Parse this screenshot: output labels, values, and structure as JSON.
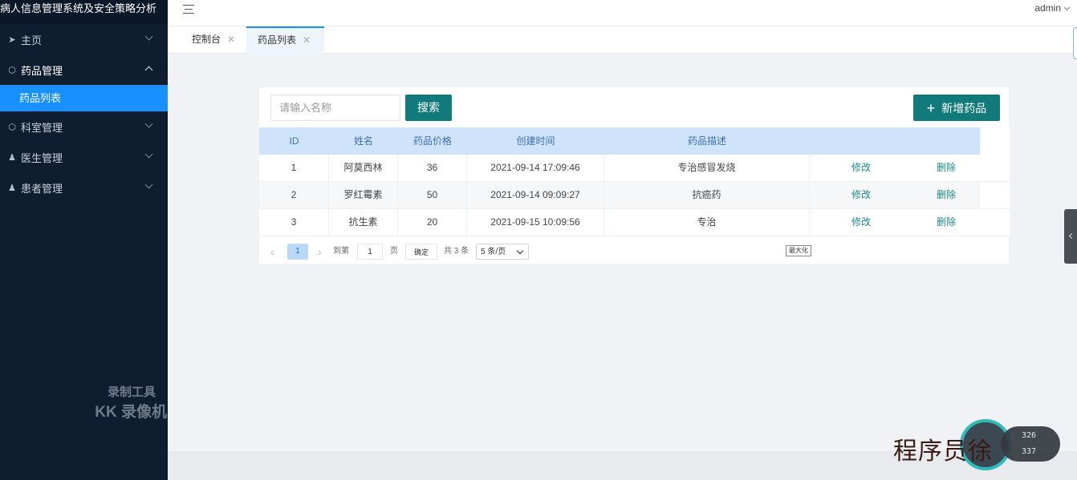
{
  "app": {
    "title": "病人信息管理系统及安全策略分析"
  },
  "sidebar": {
    "items": [
      {
        "label": "主页",
        "icon": "send-icon",
        "expanded": false
      },
      {
        "label": "药品管理",
        "icon": "cube-icon",
        "expanded": true
      },
      {
        "label": "科室管理",
        "icon": "cube-icon",
        "expanded": false
      },
      {
        "label": "医生管理",
        "icon": "user-icon",
        "expanded": false
      },
      {
        "label": "患者管理",
        "icon": "user-icon",
        "expanded": false
      }
    ],
    "sub_active": "药品列表"
  },
  "header": {
    "user": "admin"
  },
  "tabs": [
    {
      "label": "控制台",
      "active": false
    },
    {
      "label": "药品列表",
      "active": true
    }
  ],
  "toolbar": {
    "search_placeholder": "请输入名称",
    "search_label": "搜索",
    "add_label": "新增药品",
    "accent_color": "#127a7a"
  },
  "table": {
    "columns": [
      "ID",
      "姓名",
      "药品价格",
      "创建时间",
      "药品描述"
    ],
    "rows": [
      {
        "id": "1",
        "name": "阿莫西林",
        "price": "36",
        "time": "2021-09-14 17:09:46",
        "desc": "专治感冒发烧",
        "edit": "修改",
        "del": "删除"
      },
      {
        "id": "2",
        "name": "罗红霉素",
        "price": "50",
        "time": "2021-09-14 09:09:27",
        "desc": "抗癌药",
        "edit": "修改",
        "del": "删除"
      },
      {
        "id": "3",
        "name": "抗生素",
        "price": "20",
        "time": "2021-09-15 10:09:56",
        "desc": "专治",
        "edit": "修改",
        "del": "删除"
      }
    ]
  },
  "pagination": {
    "current_page": "1",
    "goto_label": "到第",
    "goto_value": "1",
    "page_unit": "页",
    "confirm_label": "确定",
    "total_label": "共 3 条",
    "page_size": "5 条/页",
    "max_tooltip": "最大化"
  },
  "overlay": {
    "watermark_line1": "录制工具",
    "watermark_line2": "KK 录像机",
    "brand": "程序员徐",
    "stat1": "326",
    "stat2": "337"
  }
}
